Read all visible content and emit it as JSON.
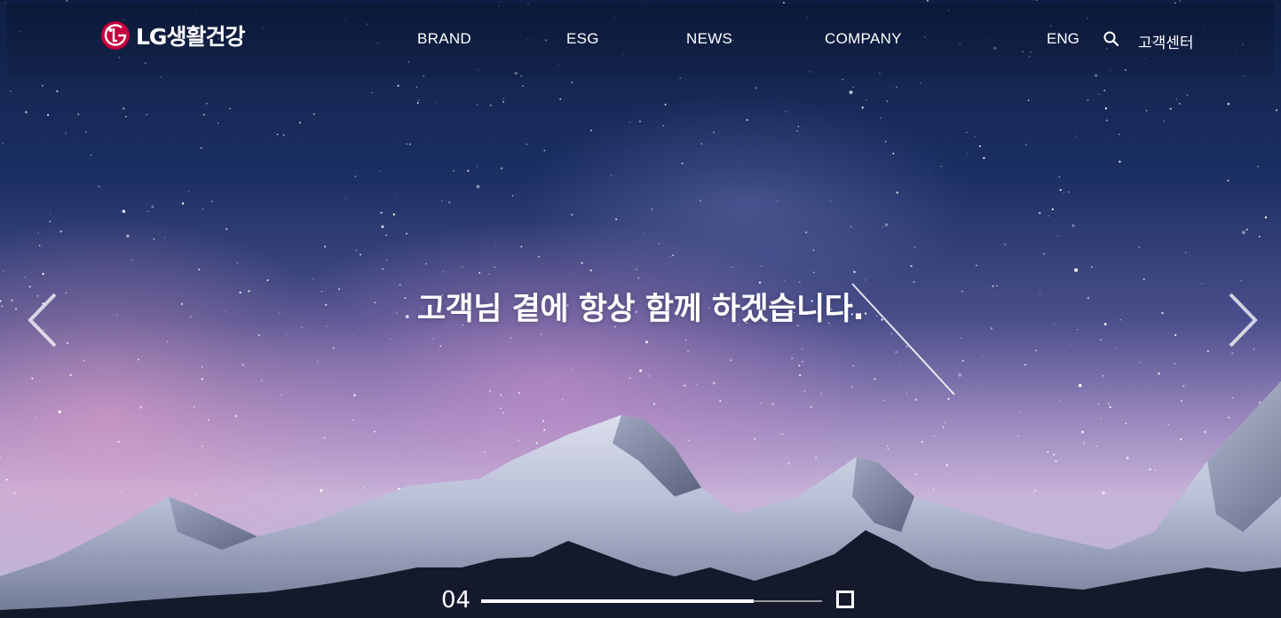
{
  "brand": {
    "logo_text": "LG생활건강"
  },
  "nav": {
    "items": [
      {
        "label": "BRAND"
      },
      {
        "label": "ESG"
      },
      {
        "label": "NEWS"
      },
      {
        "label": "COMPANY"
      }
    ]
  },
  "utility": {
    "language_label": "ENG",
    "search_icon": "search-icon",
    "customer_center_label": "고객센터"
  },
  "hero": {
    "headline": "고객님 곁에 항상 함께 하겠습니다.",
    "slide_number": "04",
    "slide_progress": 0.8
  },
  "colors": {
    "logo_red": "#c5003e",
    "text": "#ffffff"
  }
}
